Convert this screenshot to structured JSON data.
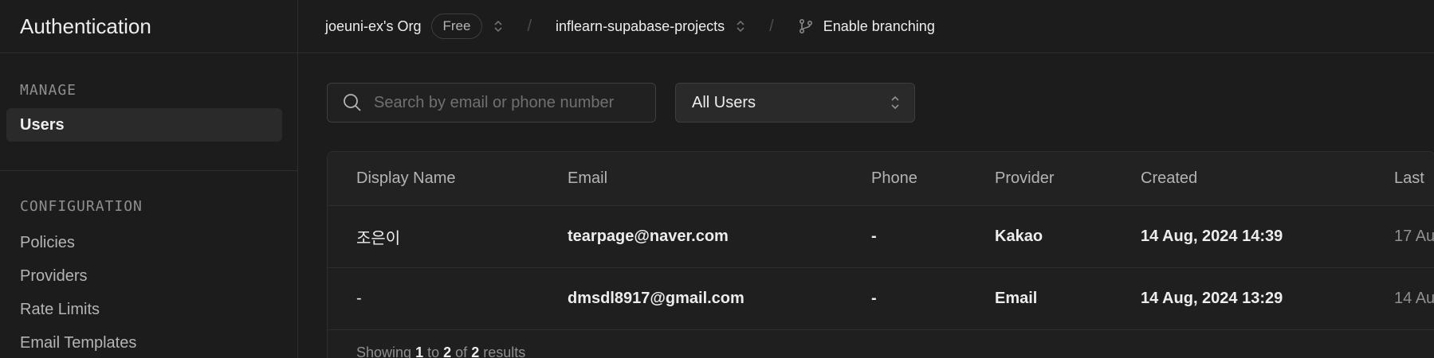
{
  "sidebar": {
    "title": "Authentication",
    "manage_label": "MANAGE",
    "manage_items": [
      {
        "label": "Users",
        "active": true
      }
    ],
    "config_label": "CONFIGURATION",
    "config_items": [
      {
        "label": "Policies"
      },
      {
        "label": "Providers"
      },
      {
        "label": "Rate Limits"
      },
      {
        "label": "Email Templates"
      }
    ]
  },
  "topbar": {
    "org": "joeuni-ex's Org",
    "plan_badge": "Free",
    "separator": "/",
    "project": "inflearn-supabase-projects",
    "branching": "Enable branching"
  },
  "toolbar": {
    "search_placeholder": "Search by email or phone number",
    "filter_value": "All Users"
  },
  "table": {
    "columns": [
      "Display Name",
      "Email",
      "Phone",
      "Provider",
      "Created",
      "Last"
    ],
    "rows": [
      {
        "name": "조은이",
        "email": "tearpage@naver.com",
        "phone": "-",
        "provider": "Kakao",
        "created": "14 Aug, 2024 14:39",
        "last": "17 Au"
      },
      {
        "name": "-",
        "email": "dmsdl8917@gmail.com",
        "phone": "-",
        "provider": "Email",
        "created": "14 Aug, 2024 13:29",
        "last": "14 Au"
      }
    ],
    "footer": {
      "prefix": "Showing",
      "from": "1",
      "to_word": "to",
      "to": "2",
      "of_word": "of",
      "total": "2",
      "suffix": "results"
    }
  },
  "colors": {
    "background": "#1c1c1c",
    "border": "#2e2e2e",
    "text": "#ededed",
    "muted": "#8f8f8f"
  },
  "icons": [
    "search-icon",
    "chevron-updown-icon",
    "git-branch-icon"
  ]
}
